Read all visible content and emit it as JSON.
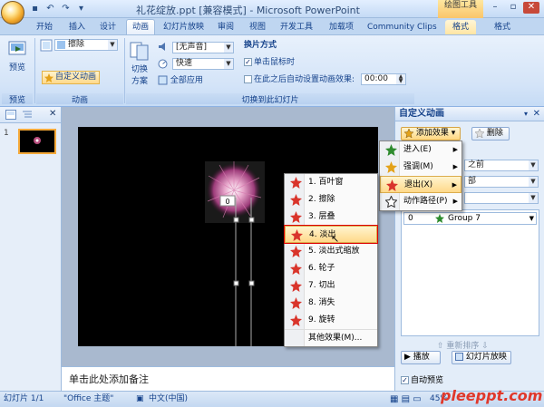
{
  "window": {
    "title": "礼花绽放.ppt [兼容模式] - Microsoft PowerPoint",
    "context_tab": "绘图工具",
    "min": "–",
    "max": "▫",
    "close": "✕"
  },
  "qat": {
    "save": "▪",
    "undo": "↶",
    "redo": "↷",
    "more": "▾"
  },
  "tabs": [
    "开始",
    "插入",
    "设计",
    "动画",
    "幻灯片放映",
    "审阅",
    "视图",
    "开发工具",
    "加载项",
    "Community Clips",
    "格式"
  ],
  "active_tab": "动画",
  "ribbon": {
    "preview": {
      "button": "预览",
      "group": "预览"
    },
    "animation": {
      "effect_label": "擦除",
      "custom_button": "自定义动画",
      "group": "动画"
    },
    "transition": {
      "scheme_button": "切换方案",
      "scheme_line1": "切换",
      "scheme_line2": "方案",
      "sound_value": "[无声音]",
      "speed_value": "快速",
      "apply_all": "全部应用",
      "advance_title": "换片方式",
      "on_click": "单击鼠标时",
      "after_time": "在此之后自动设置动画效果:",
      "time_value": "00:00",
      "group": "切换到此幻灯片"
    }
  },
  "left_panel": {
    "slide_number": "1"
  },
  "slide": {
    "tag_label": "0"
  },
  "notes": {
    "placeholder": "单击此处添加备注"
  },
  "task_pane": {
    "title": "自定义动画",
    "add_effect": "添加效果",
    "remove": "删除",
    "start_value": "之前",
    "direction_value": "部",
    "list_item": {
      "order": "0",
      "name": "Group 7"
    },
    "reorder": "重新排序",
    "play": "播放",
    "slideshow": "幻灯片放映",
    "autopreview": "自动预览"
  },
  "effect_menu": [
    {
      "label": "进入(E)",
      "icon": "star-green-icon",
      "has_sub": true
    },
    {
      "label": "强调(M)",
      "icon": "star-yellow-icon",
      "has_sub": true
    },
    {
      "label": "退出(X)",
      "icon": "star-red-icon",
      "has_sub": true,
      "selected": true
    },
    {
      "label": "动作路径(P)",
      "icon": "star-outline-icon",
      "has_sub": true
    }
  ],
  "exit_menu": [
    {
      "label": "1. 百叶窗"
    },
    {
      "label": "2. 擦除"
    },
    {
      "label": "3. 层叠"
    },
    {
      "label": "4. 淡出",
      "selected": true
    },
    {
      "label": "5. 淡出式缩放"
    },
    {
      "label": "6. 轮子"
    },
    {
      "label": "7. 切出"
    },
    {
      "label": "8. 消失"
    },
    {
      "label": "9. 旋转"
    },
    {
      "label": "其他效果(M)..."
    }
  ],
  "status": {
    "slide": "幻灯片 1/1",
    "theme": "\"Office 主题\"",
    "lang": "中文(中国)",
    "zoom": "45%",
    "watermark": "pleeppt.com"
  },
  "colors": {
    "accent": "#15428b",
    "exit_star": "#d9342b",
    "enter_star": "#2e8b2e",
    "emph_star": "#e3a21a"
  }
}
